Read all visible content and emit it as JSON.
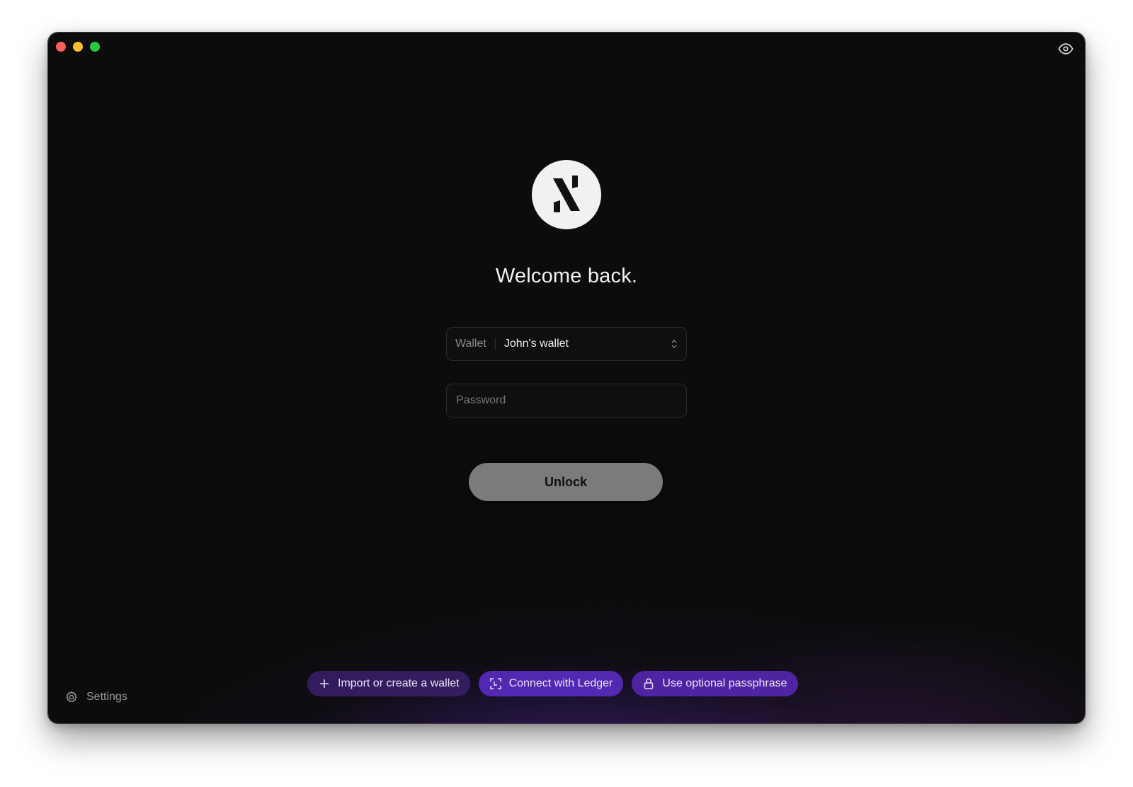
{
  "window": {
    "heading": "Welcome back."
  },
  "wallet": {
    "label": "Wallet",
    "selected": "John's wallet"
  },
  "password": {
    "placeholder": "Password",
    "value": ""
  },
  "unlock": {
    "label": "Unlock"
  },
  "actions": {
    "import_label": "Import or create a wallet",
    "ledger_label": "Connect with Ledger",
    "passphrase_label": "Use optional passphrase"
  },
  "settings": {
    "label": "Settings"
  },
  "icons": {
    "logo": "app-logo-icon",
    "eye": "eye-icon",
    "plus": "plus-icon",
    "ledger": "scan-frame-icon",
    "lock": "lock-icon",
    "gear": "gear-icon",
    "chevron": "chevron-up-down-icon"
  },
  "colors": {
    "accent": "#5a2abe",
    "background": "#0c0c0d",
    "button": "#7b7b7d"
  }
}
